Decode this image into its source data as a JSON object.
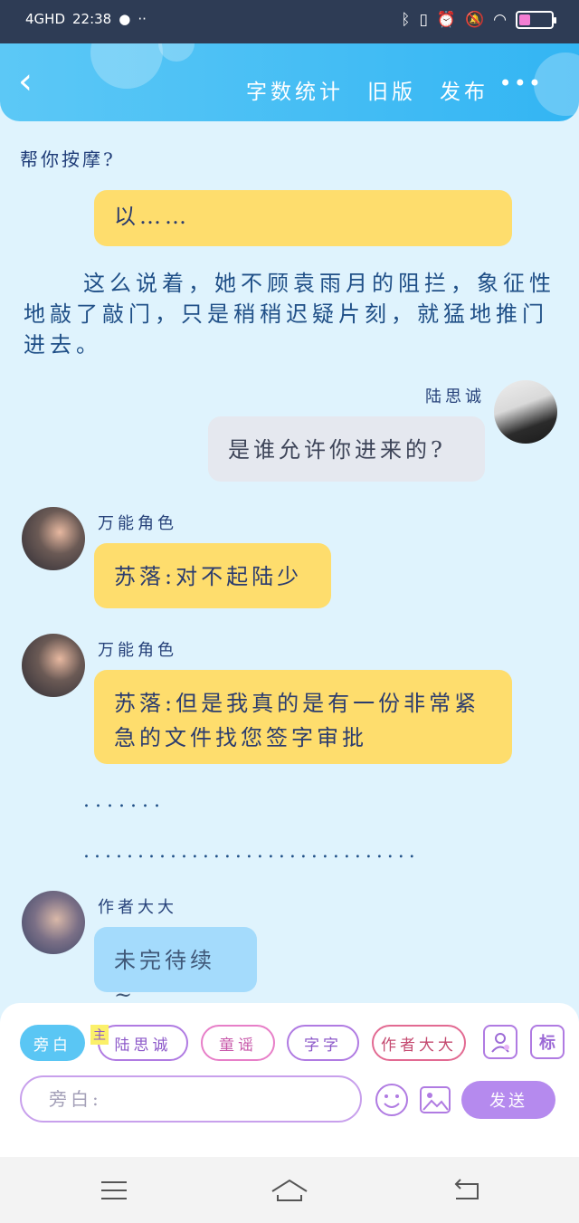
{
  "status_bar": {
    "network": "4GHD",
    "signal": "▮▮▮▮",
    "time": "22:38",
    "icons": [
      "bluetooth-icon",
      "vibrate-icon",
      "alarm-icon",
      "mute-icon",
      "wifi-icon",
      "battery-icon"
    ],
    "battery_level": 0.35
  },
  "header": {
    "back": "‹",
    "actions": [
      "字数统计",
      "旧版",
      "发布"
    ],
    "more": "•••"
  },
  "chapter": {
    "title": "帮你按摩?"
  },
  "messages": {
    "partial_text": "以……",
    "narration": "这么说着，她不顾袁雨月的阻拦，象征性地敲了敲门，只是稍稍迟疑片刻，就猛地推门进去。",
    "m1_sender": "陆思诚",
    "m1_text": "是谁允许你进来的?",
    "m2_sender": "万能角色",
    "m2_text": "苏落:对不起陆少",
    "m3_sender": "万能角色",
    "m3_text": "苏落:但是我真的是有一份非常紧急的文件找您签字审批",
    "dots_short": ".......",
    "dots_long": "...............................",
    "m4_sender": "作者大大",
    "m4_text": "未完待续~"
  },
  "panel": {
    "chips": [
      "旁白",
      "陆思诚",
      "童谣",
      "字字",
      "作者大大"
    ],
    "main_tag": "主",
    "tag_icon": "标",
    "input_placeholder": "旁白:",
    "send": "发送"
  },
  "colors": {
    "header": "#33b5f3",
    "bg": "#dff3fd",
    "yellow": "#fedd6d",
    "accent_purple": "#b58aee"
  }
}
